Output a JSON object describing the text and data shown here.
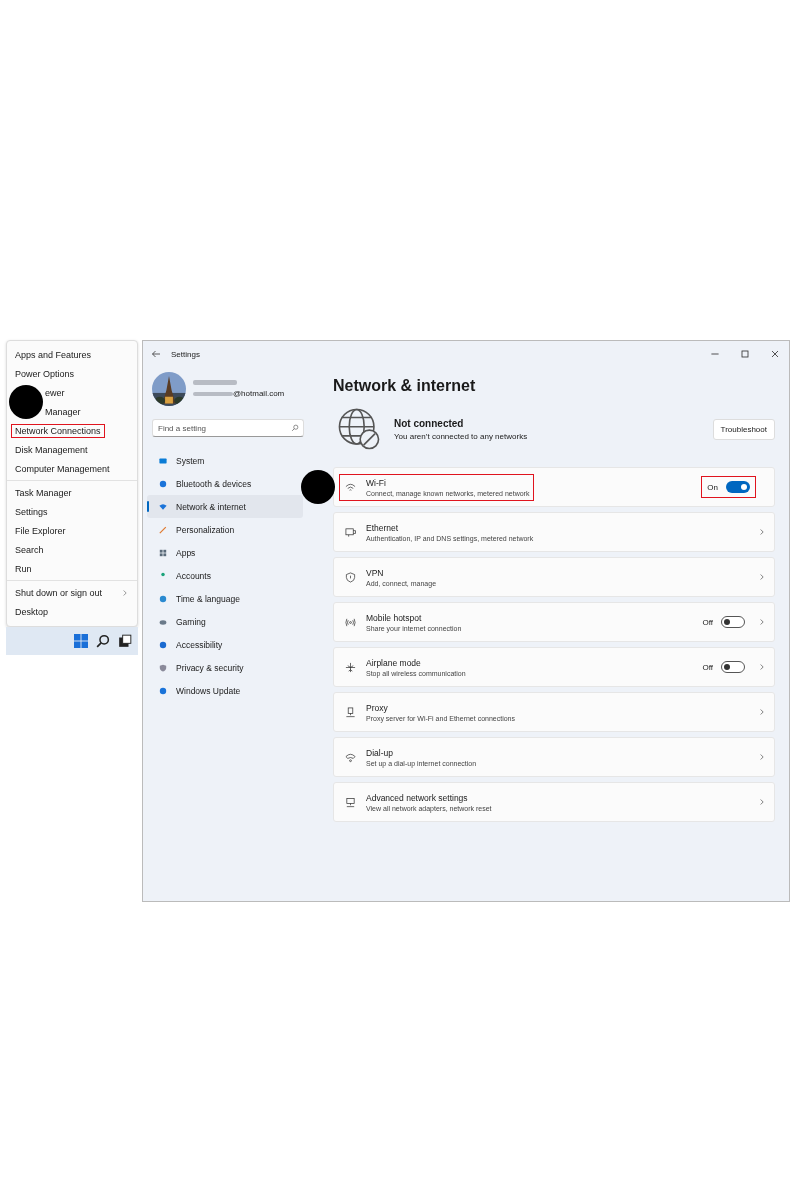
{
  "context_menu": {
    "groups": [
      {
        "items": [
          {
            "label": "Apps and Features",
            "highlighted": false,
            "callout": false,
            "submenu": false
          },
          {
            "label": "Power Options",
            "highlighted": false,
            "callout": false,
            "submenu": false
          },
          {
            "label": "ewer",
            "highlighted": false,
            "callout": true,
            "submenu": false
          },
          {
            "label": "Manager",
            "highlighted": false,
            "callout": false,
            "submenu": false
          },
          {
            "label": "Network Connections",
            "highlighted": true,
            "callout": false,
            "submenu": false
          },
          {
            "label": "Disk Management",
            "highlighted": false,
            "callout": false,
            "submenu": false
          },
          {
            "label": "Computer Management",
            "highlighted": false,
            "callout": false,
            "submenu": false
          }
        ]
      },
      {
        "items": [
          {
            "label": "Task Manager",
            "highlighted": false,
            "callout": false,
            "submenu": false
          },
          {
            "label": "Settings",
            "highlighted": false,
            "callout": false,
            "submenu": false
          },
          {
            "label": "File Explorer",
            "highlighted": false,
            "callout": false,
            "submenu": false
          },
          {
            "label": "Search",
            "highlighted": false,
            "callout": false,
            "submenu": false
          },
          {
            "label": "Run",
            "highlighted": false,
            "callout": false,
            "submenu": false
          }
        ]
      },
      {
        "items": [
          {
            "label": "Shut down or sign out",
            "highlighted": false,
            "callout": false,
            "submenu": true
          },
          {
            "label": "Desktop",
            "highlighted": false,
            "callout": false,
            "submenu": false
          }
        ]
      }
    ]
  },
  "window": {
    "title": "Settings"
  },
  "profile": {
    "email": "@hotmail.com"
  },
  "search": {
    "placeholder": "Find a setting"
  },
  "sidebar": {
    "items": [
      {
        "label": "System",
        "selected": false
      },
      {
        "label": "Bluetooth & devices",
        "selected": false
      },
      {
        "label": "Network & internet",
        "selected": true
      },
      {
        "label": "Personalization",
        "selected": false
      },
      {
        "label": "Apps",
        "selected": false
      },
      {
        "label": "Accounts",
        "selected": false
      },
      {
        "label": "Time & language",
        "selected": false
      },
      {
        "label": "Gaming",
        "selected": false
      },
      {
        "label": "Accessibility",
        "selected": false
      },
      {
        "label": "Privacy & security",
        "selected": false
      },
      {
        "label": "Windows Update",
        "selected": false
      }
    ]
  },
  "page": {
    "title": "Network & internet",
    "status": "Not connected",
    "status_detail": "You aren’t connected to any networks",
    "troubleshoot": "Troubleshoot"
  },
  "rows": [
    {
      "title": "Wi-Fi",
      "subtitle": "Connect, manage known networks, metered network",
      "kind": "toggle",
      "on": true,
      "state_label": "On",
      "chevron": false,
      "highlighted": true,
      "callout": true
    },
    {
      "title": "Ethernet",
      "subtitle": "Authentication, IP and DNS settings, metered network",
      "kind": "link",
      "chevron": true,
      "highlighted": false,
      "callout": false
    },
    {
      "title": "VPN",
      "subtitle": "Add, connect, manage",
      "kind": "link",
      "chevron": true,
      "highlighted": false,
      "callout": false
    },
    {
      "title": "Mobile hotspot",
      "subtitle": "Share your internet connection",
      "kind": "toggle",
      "on": false,
      "state_label": "Off",
      "chevron": true,
      "highlighted": false,
      "callout": false
    },
    {
      "title": "Airplane mode",
      "subtitle": "Stop all wireless communication",
      "kind": "toggle",
      "on": false,
      "state_label": "Off",
      "chevron": true,
      "highlighted": false,
      "callout": false
    },
    {
      "title": "Proxy",
      "subtitle": "Proxy server for Wi-Fi and Ethernet connections",
      "kind": "link",
      "chevron": true,
      "highlighted": false,
      "callout": false
    },
    {
      "title": "Dial-up",
      "subtitle": "Set up a dial-up internet connection",
      "kind": "link",
      "chevron": true,
      "highlighted": false,
      "callout": false
    },
    {
      "title": "Advanced network settings",
      "subtitle": "View all network adapters, network reset",
      "kind": "link",
      "chevron": true,
      "highlighted": false,
      "callout": false
    }
  ]
}
